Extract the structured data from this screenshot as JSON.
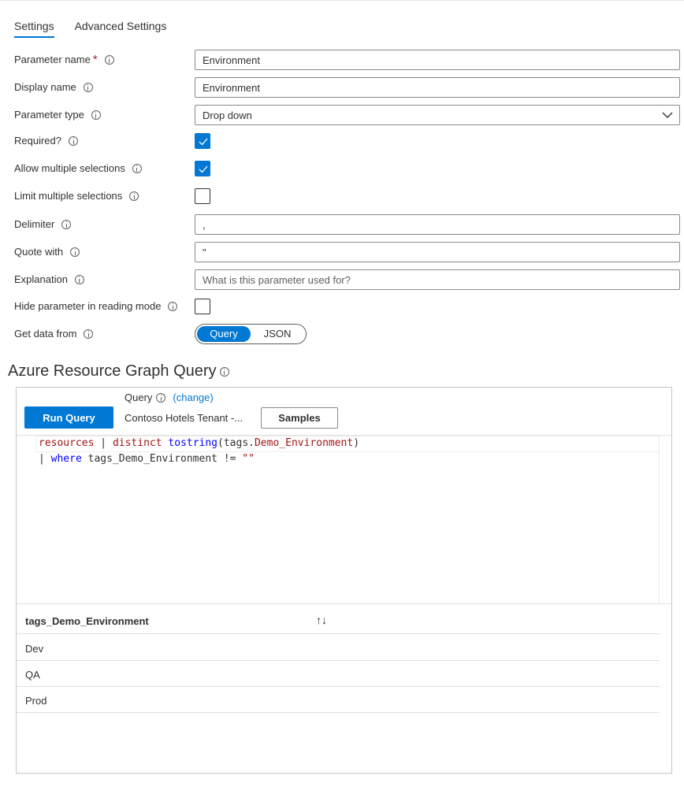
{
  "tabs": [
    {
      "label": "Settings",
      "active": true
    },
    {
      "label": "Advanced Settings",
      "active": false
    }
  ],
  "form": {
    "parameter_name": {
      "label": "Parameter name",
      "required_mark": "*",
      "value": "Environment"
    },
    "display_name": {
      "label": "Display name",
      "value": "Environment"
    },
    "parameter_type": {
      "label": "Parameter type",
      "value": "Drop down"
    },
    "required": {
      "label": "Required?",
      "checked": true
    },
    "allow_multiple": {
      "label": "Allow multiple selections",
      "checked": true
    },
    "limit_multiple": {
      "label": "Limit multiple selections",
      "checked": false
    },
    "delimiter": {
      "label": "Delimiter",
      "value": ","
    },
    "quote_with": {
      "label": "Quote with",
      "value": "\""
    },
    "explanation": {
      "label": "Explanation",
      "value": "",
      "placeholder": "What is this parameter used for?"
    },
    "hide_in_reading": {
      "label": "Hide parameter in reading mode",
      "checked": false
    },
    "get_data_from": {
      "label": "Get data from",
      "options": [
        "Query",
        "JSON"
      ],
      "selected": "Query"
    }
  },
  "query_section": {
    "title": "Azure Resource Graph Query",
    "run_query_label": "Run Query",
    "query_label": "Query",
    "change_label": "(change)",
    "source": "Contoso Hotels Tenant -...",
    "samples_label": "Samples",
    "code": {
      "line1": {
        "t1": "resources",
        "t2": " | ",
        "t3": "distinct",
        "t4": " ",
        "t5": "tostring",
        "t6": "(tags.",
        "t7": "Demo_Environment",
        "t8": ")"
      },
      "line2": {
        "t1": "| ",
        "t2": "where",
        "t3": " tags_Demo_Environment != ",
        "t4": "\"\""
      }
    }
  },
  "results": {
    "column": "tags_Demo_Environment",
    "sort_icon": "↑↓",
    "rows": [
      "Dev",
      "QA",
      "Prod"
    ]
  },
  "colors": {
    "accent": "#0078d4",
    "required": "#a4262c"
  }
}
